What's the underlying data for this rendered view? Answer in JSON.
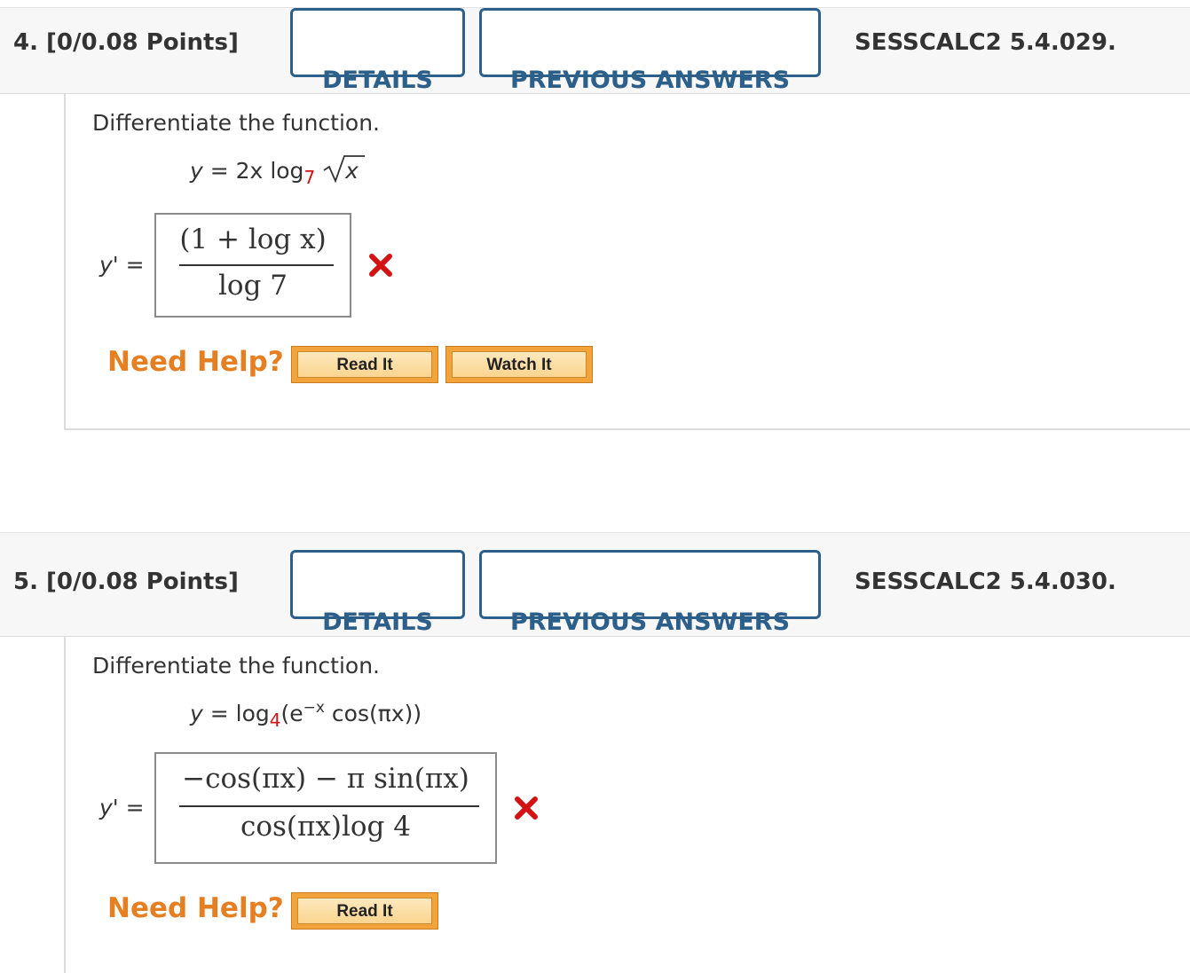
{
  "questions": [
    {
      "number": "4.",
      "points": "[0/0.08 Points]",
      "details_label": "DETAILS",
      "previous_answers_label": "PREVIOUS ANSWERS",
      "code": "SESSCALC2 5.4.029.",
      "prompt": "Differentiate the function.",
      "function": {
        "lhs": "y",
        "eq": "=",
        "coef": "2x",
        "log": "log",
        "base": "7",
        "radicand": "x"
      },
      "answer_label": "y' =",
      "answer": {
        "numerator": "(1 + log x)",
        "denominator": "log 7"
      },
      "status": "incorrect",
      "need_help": "Need Help?",
      "help_buttons": [
        "Read It",
        "Watch It"
      ]
    },
    {
      "number": "5.",
      "points": "[0/0.08 Points]",
      "details_label": "DETAILS",
      "previous_answers_label": "PREVIOUS ANSWERS",
      "code": "SESSCALC2 5.4.030.",
      "prompt": "Differentiate the function.",
      "function": {
        "lhs": "y",
        "eq": "=",
        "log": "log",
        "base": "4",
        "open": "(e",
        "exp": "−x",
        "rest": "cos(πx))"
      },
      "answer_label": "y' =",
      "answer": {
        "numerator": "−cos(πx) − π sin(πx)",
        "denominator": "cos(πx)log 4"
      },
      "status": "incorrect",
      "need_help": "Need Help?",
      "help_buttons": [
        "Read It"
      ]
    }
  ],
  "colors": {
    "accent": "#2c5f8a",
    "incorrect": "#d31313",
    "help": "#e67e22",
    "button": "#f2a33a"
  }
}
